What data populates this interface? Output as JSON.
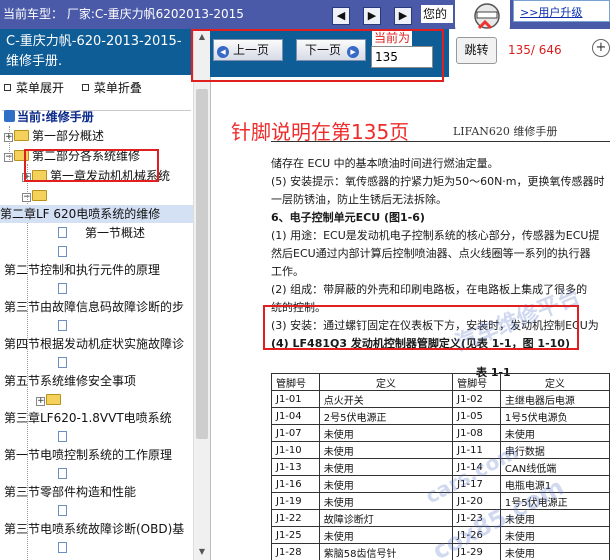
{
  "topbar": {
    "car_model": "当前车型：   厂家:C-重庆力帆6202013-2015",
    "hello_text": "您的",
    "user_center_link": ">>用户升级"
  },
  "sidebar": {
    "book_title": "C-重庆力帆-620-2013-2015- 维修手册.",
    "expand_label": "菜单展开",
    "collapse_label": "菜单折叠",
    "current_label": "当前:维修手册",
    "tree": [
      "第一部分概述",
      "第二部分各系统维修",
      "第一章发动机机械系统",
      "",
      "第二章LF 620电喷系统的维修",
      "第一节概述",
      "",
      "第二节控制和执行元件的原理",
      "",
      "第三节由故障信息码故障诊断的步",
      "",
      "第四节根据发动机症状实施故障诊",
      "",
      "第五节系统维修安全事项",
      "",
      "第三章LF620-1.8VVT电喷系统",
      "",
      "第一节电喷控制系统的工作原理",
      "",
      "第三节零部件构造和性能",
      "",
      "第三节电喷系统故障诊断(OBD)基"
    ]
  },
  "viewer": {
    "prev_label": "上一页",
    "next_label": "下一页",
    "current_label": "当前为",
    "page_value": "135",
    "jump_label": "跳转",
    "page_count": "135/ 646"
  },
  "document": {
    "annotation": "针脚说明在第135页",
    "manual_title": "LIFAN620 维修手册",
    "paragraphs": [
      "储存在 ECU 中的基本喷油时间进行燃油定量。",
      "(5) 安装提示：氧传感器的拧紧力矩为50～60N·m，更换氧传感器时",
      "一层防锈油，防止生锈后无法拆除。",
      "6、电子控制单元ECU (图1-6)",
      "(1) 用途：ECU是发动机电子控制系统的核心部分，传感器为ECU提",
      "然后ECU通过内部计算后控制喷油器、点火线圈等一系列的执行器",
      "工作。",
      "(2) 组成：带屏蔽的外壳和印刷电路板，在电路板上集成了很多的",
      "统的控制。",
      "(3) 安装：通过螺钉固定在仪表板下方，安装时，发动机控制ECU为",
      "(4) LF481Q3 发动机控制器管脚定义(见表 1-1，图 1-10)"
    ],
    "table_caption": "表 1-1",
    "table_headers": [
      "管脚号",
      "定义",
      "管脚号",
      "定义"
    ],
    "table_rows": [
      [
        "J1-01",
        "点火开关",
        "J1-02",
        "主继电器后电源"
      ],
      [
        "J1-04",
        "2号5伏电源正",
        "J1-05",
        "1号5伏电源负"
      ],
      [
        "J1-07",
        "未使用",
        "J1-08",
        "未使用"
      ],
      [
        "J1-10",
        "未使用",
        "J1-11",
        "串行数据"
      ],
      [
        "J1-13",
        "未使用",
        "J1-14",
        "CAN线低端"
      ],
      [
        "J1-16",
        "未使用",
        "J1-17",
        "电瓶电源1"
      ],
      [
        "J1-19",
        "未使用",
        "J1-20",
        "1号5伏电源正"
      ],
      [
        "J1-22",
        "故障诊断灯",
        "J1-23",
        "未使用"
      ],
      [
        "J1-25",
        "未使用",
        "J1-26",
        "未使用"
      ],
      [
        "J1-28",
        "紫脑58齿信号针",
        "J1-29",
        "未使用"
      ]
    ],
    "watermarks": [
      "汽车维修平台",
      "cars.com",
      "cox85.com"
    ]
  }
}
